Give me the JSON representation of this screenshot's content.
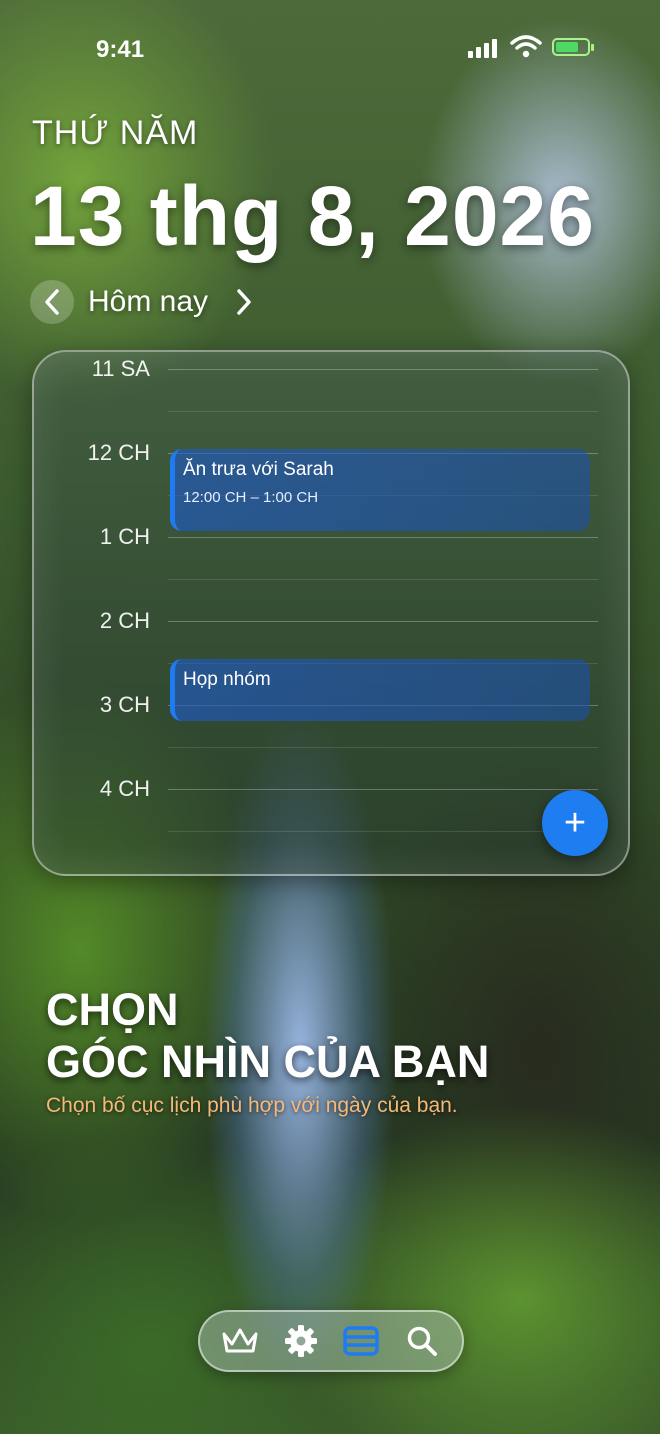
{
  "status_bar": {
    "time": "9:41",
    "signal_icon": "cellular-signal-icon",
    "wifi_icon": "wifi-icon",
    "battery_icon": "battery-charging-icon"
  },
  "header": {
    "weekday": "THỨ NĂM",
    "date": "13 thg 8, 2026",
    "day_nav": {
      "label": "Hôm nay",
      "prev_icon": "chevron-left-icon",
      "next_icon": "chevron-right-icon"
    }
  },
  "calendar": {
    "hours": [
      "11 SA",
      "12 CH",
      "1 CH",
      "2 CH",
      "3 CH",
      "4 CH"
    ],
    "events": [
      {
        "title": "Ăn trưa với Sarah",
        "time": "12:00 CH – 1:00 CH",
        "color": "#1f7bf2"
      },
      {
        "title": "Họp nhóm",
        "time": "",
        "color": "#1f7bf2"
      }
    ],
    "add_button": "+",
    "add_icon": "plus-icon"
  },
  "promo": {
    "title_line1": "CHỌN",
    "title_line2": "GÓC NHÌN CỦA BẠN",
    "subtitle": "Chọn bố cục lịch phù hợp với ngày của bạn.",
    "subtitle_color": "#f4b877"
  },
  "tab_bar": {
    "items": [
      {
        "name": "premium",
        "icon": "crown-icon",
        "active": false
      },
      {
        "name": "settings",
        "icon": "gear-icon",
        "active": false
      },
      {
        "name": "calendar-view",
        "icon": "calendar-layout-icon",
        "active": true
      },
      {
        "name": "search",
        "icon": "search-icon",
        "active": false
      }
    ],
    "active_color": "#1f7bf2"
  }
}
